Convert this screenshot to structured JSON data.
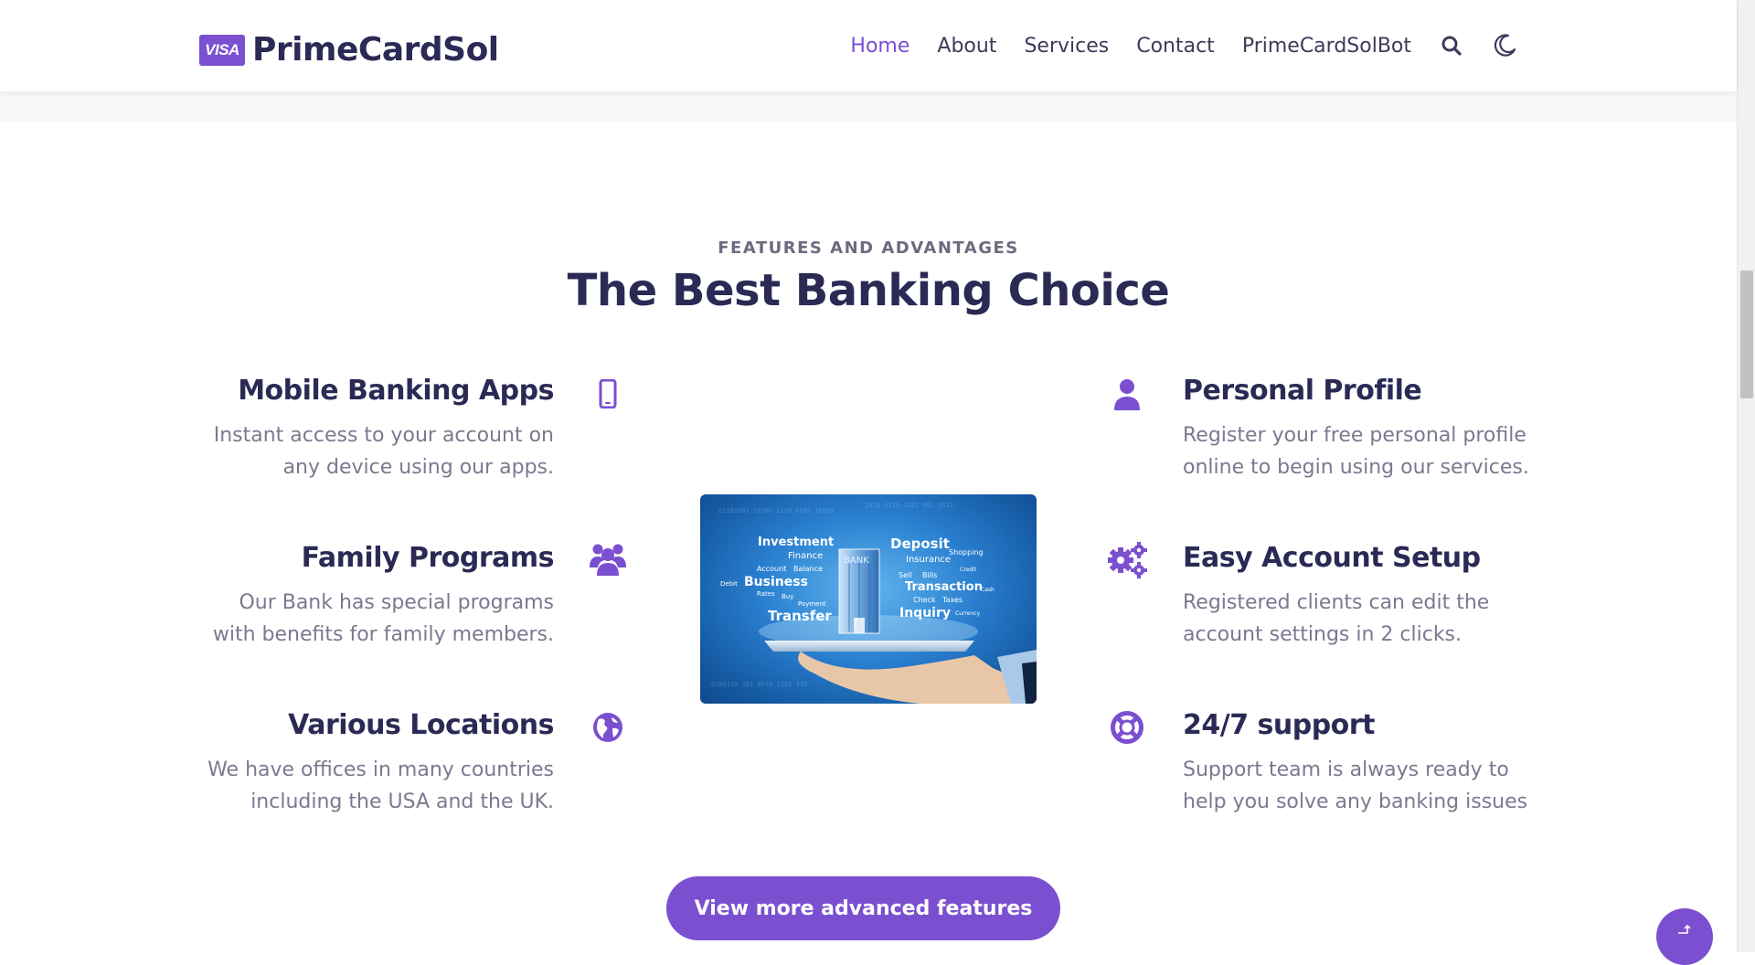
{
  "brand": {
    "badge_text": "VISA",
    "name": "PrimeCardSol",
    "accent_color": "#7a4fd0",
    "text_color": "#2b2a55"
  },
  "nav": {
    "items": [
      {
        "label": "Home",
        "active": true
      },
      {
        "label": "About",
        "active": false
      },
      {
        "label": "Services",
        "active": false
      },
      {
        "label": "Contact",
        "active": false
      },
      {
        "label": "PrimeCardSolBot",
        "active": false
      }
    ],
    "search_icon": "search-icon",
    "theme_icon": "moon-icon"
  },
  "section": {
    "eyebrow": "FEATURES AND ADVANTAGES",
    "title": "The Best Banking Choice"
  },
  "features_left": [
    {
      "title": "Mobile Banking Apps",
      "desc_line1": "Instant access to your account on",
      "desc_line2": "any device using our apps.",
      "icon": "mobile-phone-icon"
    },
    {
      "title": "Family Programs",
      "desc_line1": "Our Bank has special programs",
      "desc_line2": "with benefits for family members.",
      "icon": "users-group-icon"
    },
    {
      "title": "Various Locations",
      "desc_line1": "We have offices in many countries",
      "desc_line2": "including the USA and the UK.",
      "icon": "globe-icon"
    }
  ],
  "features_right": [
    {
      "title": "Personal Profile",
      "desc_line1": "Register your free personal profile",
      "desc_line2": "online to begin using our services.",
      "icon": "user-icon"
    },
    {
      "title": "Easy Account Setup",
      "desc_line1": "Registered clients can edit the",
      "desc_line2": "account settings in 2 clicks.",
      "icon": "gears-icon"
    },
    {
      "title": "24/7 support",
      "desc_line1": "Support team is always ready to",
      "desc_line2": "help you solve any banking issues",
      "icon": "life-ring-icon"
    }
  ],
  "image": {
    "words": [
      "Investment",
      "Finance",
      "Account",
      "Balance",
      "Debit",
      "Business",
      "Rates",
      "Buy",
      "Payment",
      "Transfer",
      "BANK",
      "Deposit",
      "Shopping",
      "Insurance",
      "Credit",
      "Sell",
      "Bills",
      "Transaction",
      "Cash",
      "Check",
      "Taxes",
      "Inquiry",
      "Currency"
    ]
  },
  "cta": {
    "label": "View more advanced features"
  },
  "scroll_top_icon": "arrow-up-icon"
}
